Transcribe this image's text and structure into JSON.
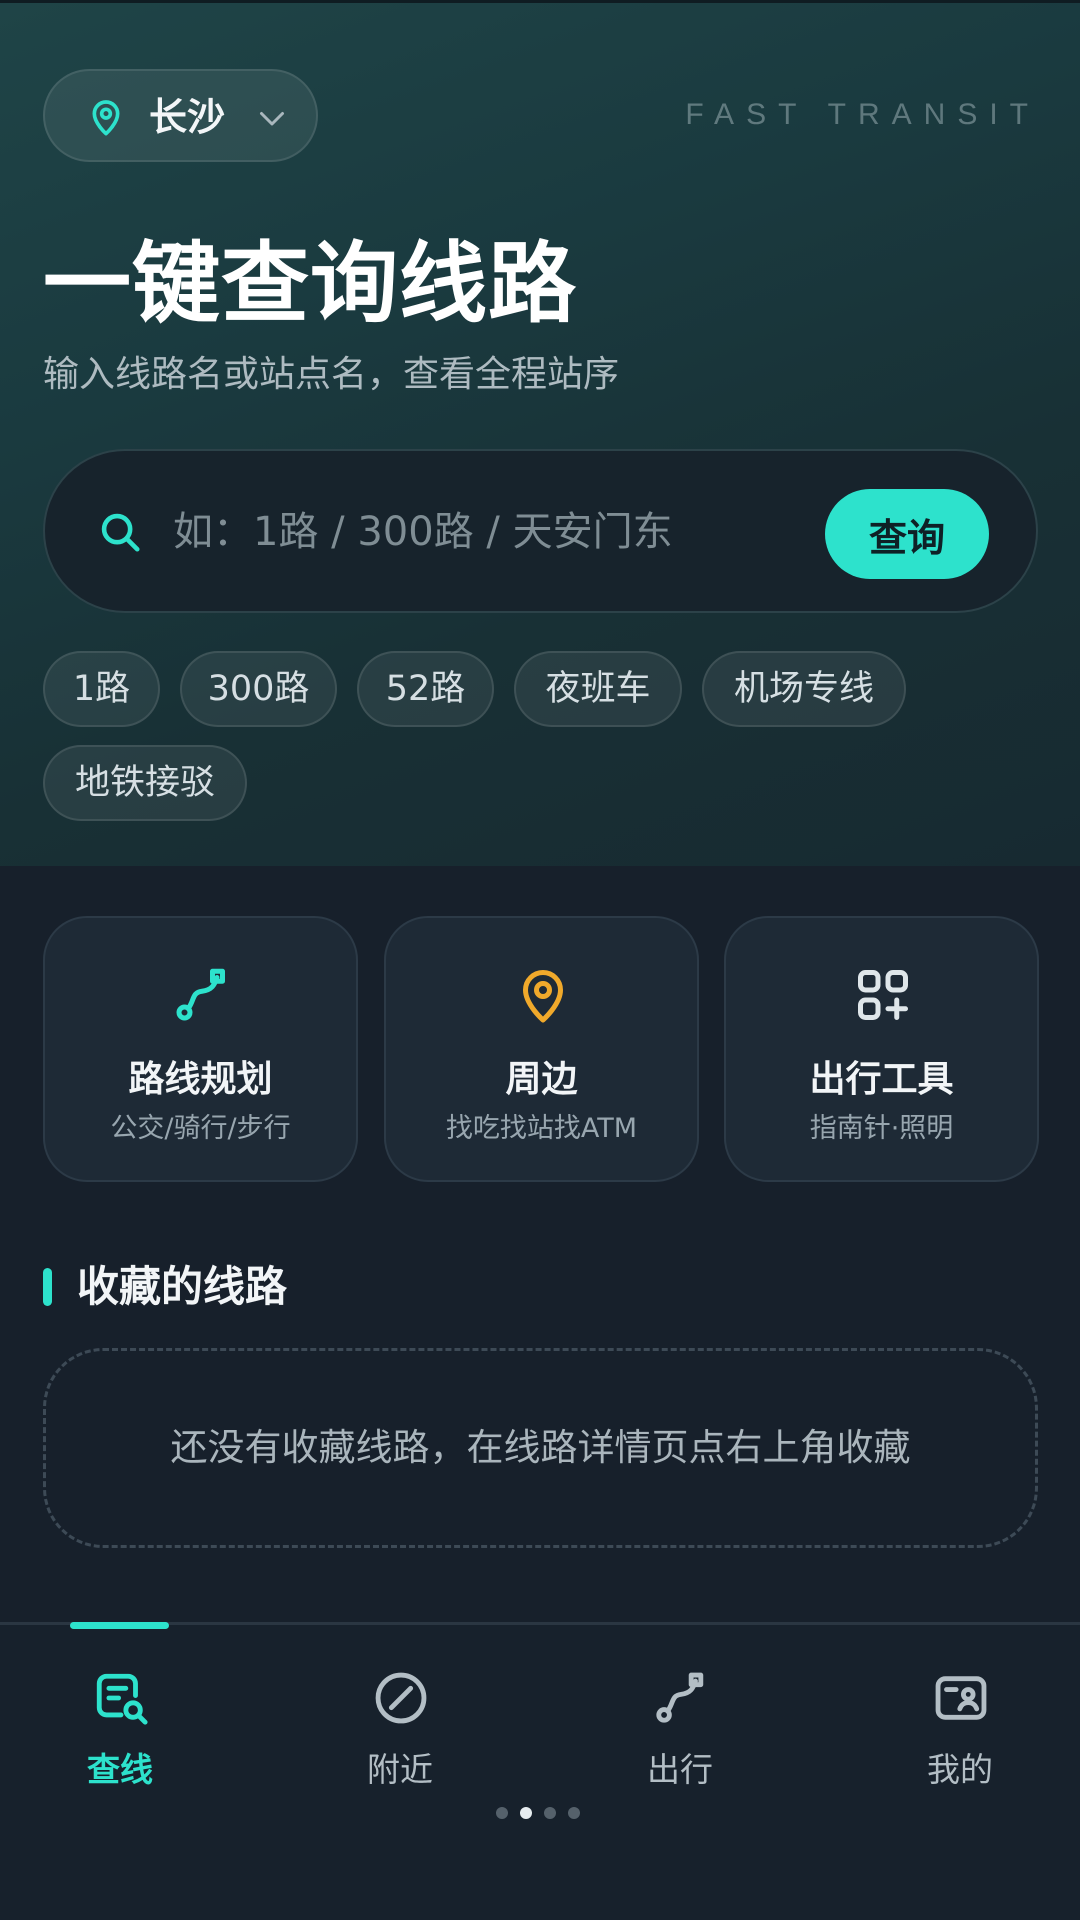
{
  "header": {
    "city": "长沙",
    "brand": "FAST TRANSIT",
    "headline": "一键查询线路",
    "subline": "输入线路名或站点名，查看全程站序"
  },
  "search": {
    "placeholder": "如：1路 / 300路 / 天安门东",
    "value": "",
    "button_label": "查询"
  },
  "quick_chips": [
    "1路",
    "300路",
    "52路",
    "夜班车",
    "机场专线",
    "地铁接驳"
  ],
  "features": [
    {
      "title": "路线规划",
      "subtitle": "公交/骑行/步行",
      "icon": "route-icon"
    },
    {
      "title": "周边",
      "subtitle": "找吃找站找ATM",
      "icon": "location-pin-icon"
    },
    {
      "title": "出行工具",
      "subtitle": "指南针·照明",
      "icon": "apps-add-icon"
    }
  ],
  "favorites": {
    "title": "收藏的线路",
    "empty_text": "还没有收藏线路，在线路详情页点右上角收藏"
  },
  "bottom_nav": [
    {
      "label": "查线",
      "icon": "search-list-icon",
      "active": true
    },
    {
      "label": "附近",
      "icon": "compass-icon",
      "active": false
    },
    {
      "label": "出行",
      "icon": "route-icon",
      "active": false
    },
    {
      "label": "我的",
      "icon": "profile-card-icon",
      "active": false
    }
  ],
  "page_indicator": {
    "count": 4,
    "active_index": 1
  },
  "colors": {
    "accent": "#2de2cc",
    "nearby_accent": "#f0a92b",
    "background": "#17202b",
    "card": "#1e2a36"
  }
}
